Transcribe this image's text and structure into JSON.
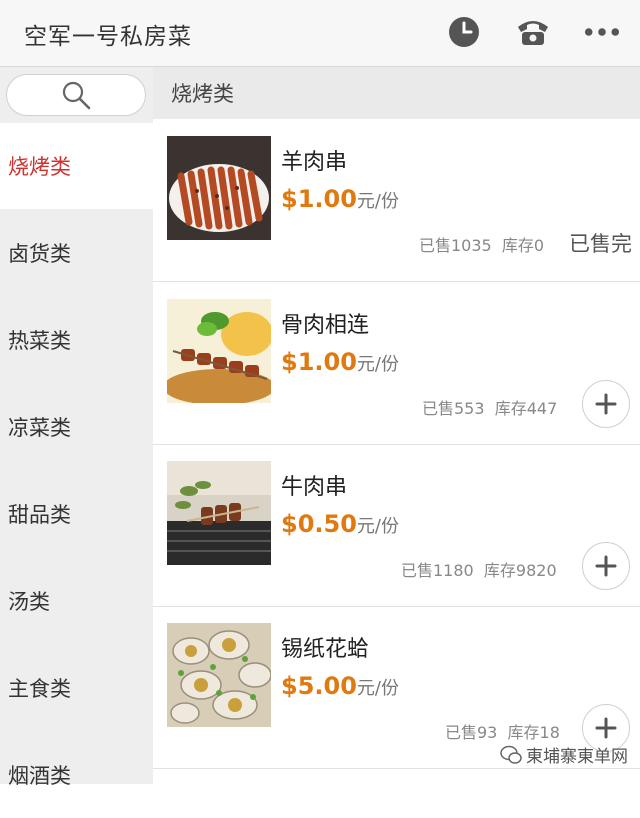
{
  "header": {
    "title": "空军一号私房菜",
    "icons": [
      "clock-icon",
      "phone-icon",
      "more-icon"
    ]
  },
  "search": {
    "icon": "search-icon"
  },
  "categories": [
    {
      "label": "烧烤类",
      "active": true
    },
    {
      "label": "卤货类"
    },
    {
      "label": "热菜类"
    },
    {
      "label": "凉菜类"
    },
    {
      "label": "甜品类"
    },
    {
      "label": "汤类"
    },
    {
      "label": "主食类"
    },
    {
      "label": "烟酒类"
    }
  ],
  "section": {
    "title": "烧烤类"
  },
  "items": [
    {
      "name": "羊肉串",
      "price": "$1.00",
      "unit": "元/份",
      "sold": "已售1035",
      "stock": "库存0",
      "status": "已售完"
    },
    {
      "name": "骨肉相连",
      "price": "$1.00",
      "unit": "元/份",
      "sold": "已售553",
      "stock": "库存447"
    },
    {
      "name": "牛肉串",
      "price": "$0.50",
      "unit": "元/份",
      "sold": "已售1180",
      "stock": "库存9820"
    },
    {
      "name": "锡纸花蛤",
      "price": "$5.00",
      "unit": "元/份",
      "sold": "已售93",
      "stock": "库存18"
    }
  ],
  "watermark": {
    "text": "東埔寨東单网"
  },
  "colors": {
    "accent_red": "#d0312d",
    "price_orange": "#e07a10"
  }
}
